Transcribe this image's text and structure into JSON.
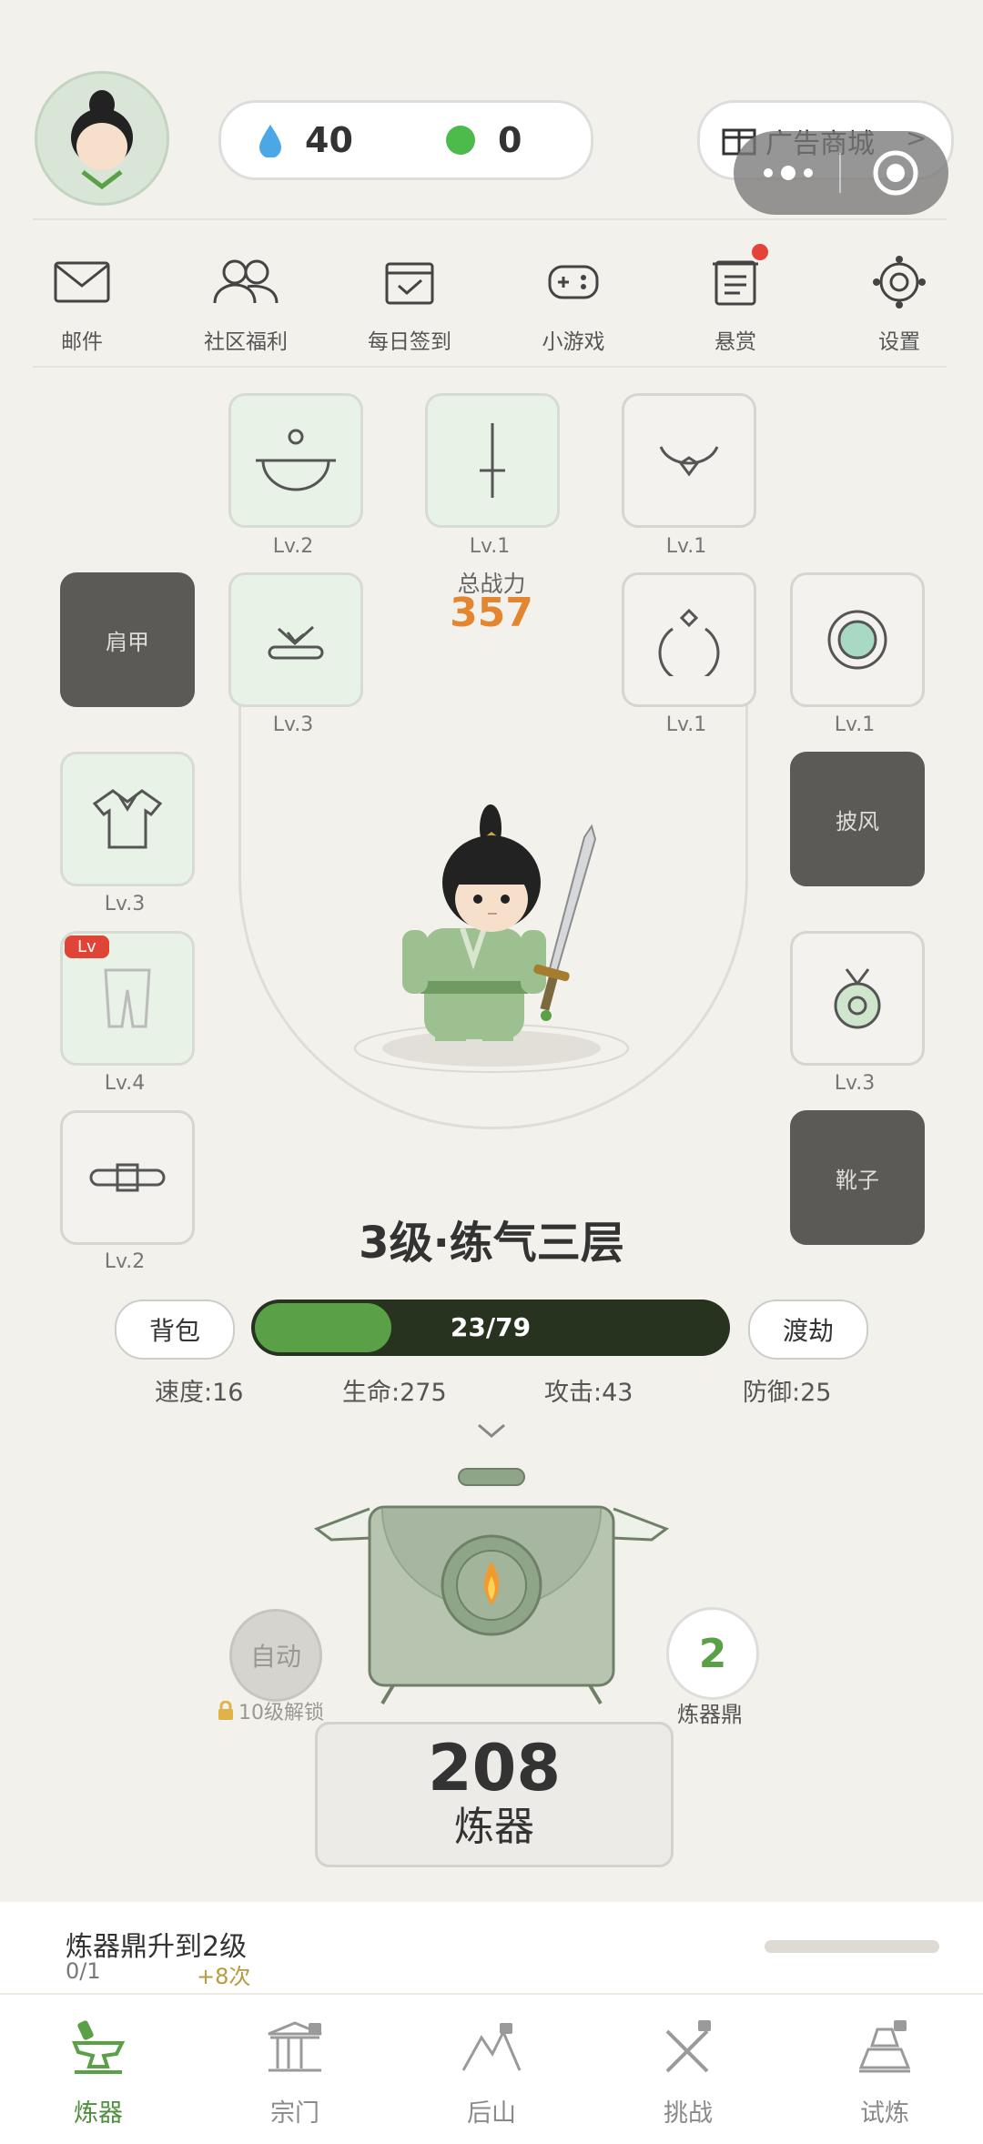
{
  "header": {
    "water_count": "40",
    "gem_count": "0",
    "shop_label": "广告商城",
    "shop_arrow": ">"
  },
  "nav": {
    "items": [
      {
        "label": "邮件",
        "icon": "mail-icon"
      },
      {
        "label": "社区福利",
        "icon": "community-icon"
      },
      {
        "label": "每日签到",
        "icon": "checkin-icon"
      },
      {
        "label": "小游戏",
        "icon": "gamepad-icon"
      },
      {
        "label": "悬赏",
        "icon": "bounty-icon"
      },
      {
        "label": "设置",
        "icon": "settings-icon"
      }
    ]
  },
  "equipment": {
    "slots": [
      {
        "id": "hat",
        "level": "Lv.2"
      },
      {
        "id": "sword",
        "level": "Lv.1"
      },
      {
        "id": "necklace",
        "level": "Lv.1"
      },
      {
        "id": "shoulder",
        "label": "肩甲"
      },
      {
        "id": "hairpin",
        "level": "Lv.3"
      },
      {
        "id": "ring",
        "level": "Lv.1"
      },
      {
        "id": "jade",
        "level": "Lv.1"
      },
      {
        "id": "robe",
        "level": "Lv.3"
      },
      {
        "id": "cape",
        "label": "披风"
      },
      {
        "id": "pants",
        "level": "Lv.4",
        "badge": "Lv"
      },
      {
        "id": "pendant",
        "level": "Lv.3"
      },
      {
        "id": "belt",
        "level": "Lv.2"
      },
      {
        "id": "boots",
        "label": "靴子"
      }
    ]
  },
  "power": {
    "label": "总战力",
    "value": "357"
  },
  "character": {
    "realm": "3级·练气三层",
    "xp_text": "23/79",
    "xp_fraction": 0.29,
    "bag_label": "背包",
    "tribulation_label": "渡劫"
  },
  "stats": {
    "speed": "速度:16",
    "hp": "生命:275",
    "attack": "攻击:43",
    "defense": "防御:25"
  },
  "forge": {
    "auto_label": "自动",
    "auto_lock_text": "10级解锁",
    "cauldron_level": "2",
    "cauldron_label": "炼器鼎",
    "count": "208",
    "action_label": "炼器"
  },
  "quest": {
    "title": "炼器鼎升到2级",
    "progress": "0/1",
    "reward": "+8次"
  },
  "tabs": [
    {
      "label": "炼器",
      "active": true
    },
    {
      "label": "宗门",
      "active": false
    },
    {
      "label": "后山",
      "active": false
    },
    {
      "label": "挑战",
      "active": false
    },
    {
      "label": "试炼",
      "active": false
    }
  ],
  "colors": {
    "accent_green": "#5aa047",
    "power_orange": "#e3862f",
    "dark_slot": "#5c5a56",
    "background": "#f3f1ec"
  }
}
